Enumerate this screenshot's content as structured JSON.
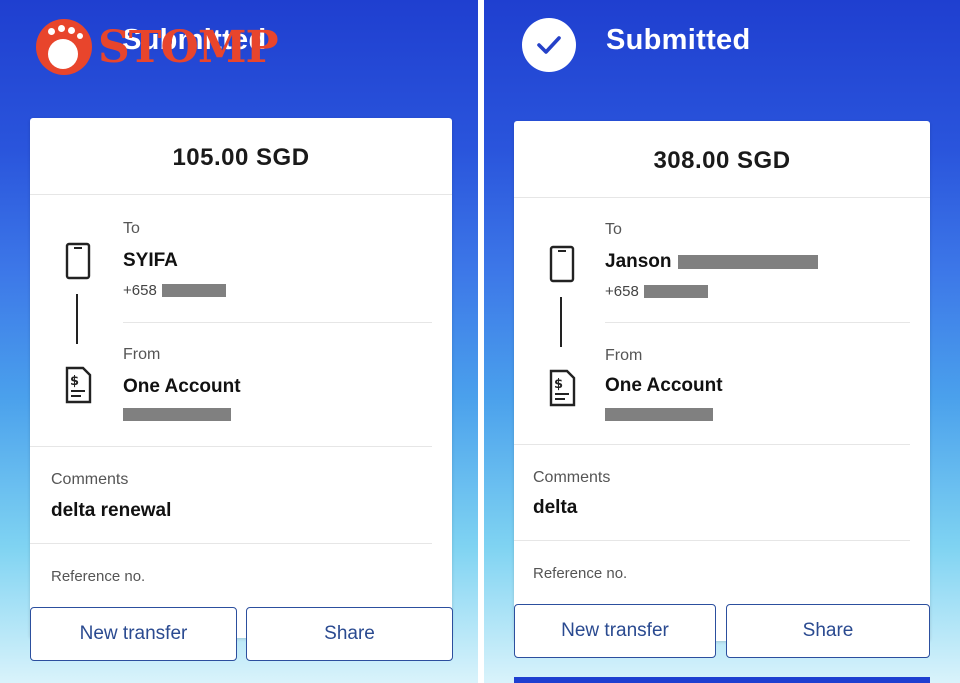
{
  "watermark": {
    "brand": "STOMP"
  },
  "left": {
    "header_title": "Submitted",
    "amount": "105.00 SGD",
    "to_label": "To",
    "to_name": "SYIFA",
    "to_phone": "+658",
    "from_label": "From",
    "from_account": "One Account",
    "comments_label": "Comments",
    "comments_value": "delta renewal",
    "reference_label": "Reference no.",
    "buttons": {
      "new_transfer": "New transfer",
      "share": "Share"
    }
  },
  "right": {
    "header_title": "Submitted",
    "amount": "308.00 SGD",
    "to_label": "To",
    "to_name": "Janson",
    "to_phone": "+658",
    "from_label": "From",
    "from_account": "One Account",
    "comments_label": "Comments",
    "comments_value": "delta",
    "reference_label": "Reference no.",
    "buttons": {
      "new_transfer": "New transfer",
      "share": "Share"
    }
  },
  "colors": {
    "header_gradient_top": "#1f3fd0",
    "button_border": "#2c4f9e",
    "button_text": "#2a4a90",
    "logo": "#e8452c",
    "redaction": "#808080"
  },
  "icons": [
    "check-icon",
    "phone-icon",
    "account-statement-icon"
  ]
}
